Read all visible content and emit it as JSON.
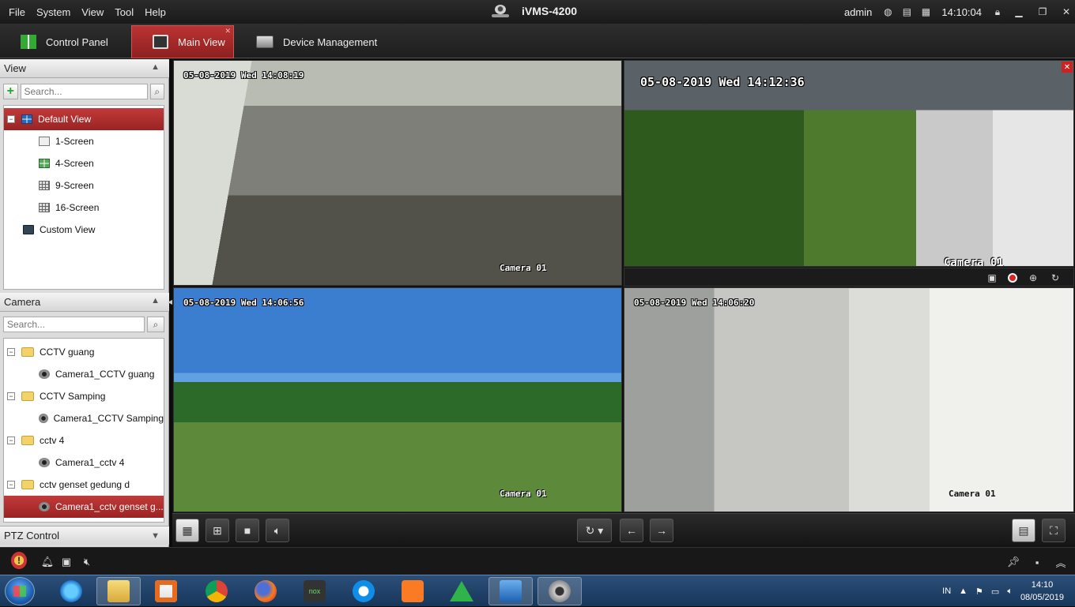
{
  "titlebar": {
    "menu": [
      "File",
      "System",
      "View",
      "Tool",
      "Help"
    ],
    "app_title": "iVMS-4200",
    "user": "admin",
    "time": "14:10:04"
  },
  "tabs": [
    {
      "label": "Control Panel",
      "active": false
    },
    {
      "label": "Main View",
      "active": true
    },
    {
      "label": "Device Management",
      "active": false
    }
  ],
  "view_panel": {
    "header": "View",
    "search_placeholder": "Search...",
    "items": [
      {
        "label": "Default View",
        "selected": true
      },
      {
        "label": "1-Screen"
      },
      {
        "label": "4-Screen"
      },
      {
        "label": "9-Screen"
      },
      {
        "label": "16-Screen"
      },
      {
        "label": "Custom View"
      }
    ]
  },
  "camera_panel": {
    "header": "Camera",
    "search_placeholder": "Search...",
    "groups": [
      {
        "label": "CCTV guang",
        "camera": "Camera1_CCTV guang"
      },
      {
        "label": "CCTV Samping",
        "camera": "Camera1_CCTV Samping"
      },
      {
        "label": "cctv 4",
        "camera": "Camera1_cctv 4"
      },
      {
        "label": "cctv genset gedung d",
        "camera": "Camera1_cctv genset g..."
      }
    ]
  },
  "ptz": {
    "header": "PTZ Control"
  },
  "panes": [
    {
      "timestamp": "05-08-2019 Wed 14:08:19",
      "label": "Camera 01"
    },
    {
      "timestamp": "05-08-2019 Wed 14:12:36",
      "label": "Camera 01"
    },
    {
      "timestamp": "05-08-2019 Wed 14:06:56",
      "label": "Camera 01"
    },
    {
      "timestamp": "05-08-2019 Wed 14:06:20",
      "label": "Camera 01"
    }
  ],
  "taskbar": {
    "lang": "IN",
    "time": "14:10",
    "date": "08/05/2019"
  },
  "colors": {
    "accent_red": "#a82a2a",
    "taskbar_blue": "#1f4470"
  }
}
